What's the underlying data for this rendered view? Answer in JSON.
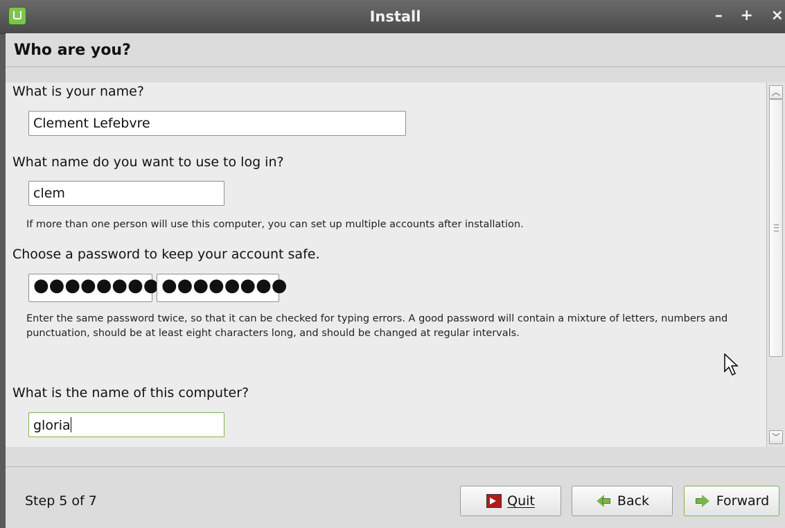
{
  "window": {
    "title": "Install",
    "controls": [
      "–",
      "+",
      "×"
    ]
  },
  "header": {
    "title": "Who are you?"
  },
  "form": {
    "name_question": "What is your name?",
    "name_value": "Clement Lefebvre",
    "login_question": "What name do you want to use to log in?",
    "login_value": "clem",
    "login_hint": "If more than one person will use this computer, you can set up multiple accounts after installation.",
    "password_question": "Choose a password to keep your account safe.",
    "password_value": "●●●●●●●●",
    "password_confirm_value": "●●●●●●●●",
    "password_hint": "Enter the same password twice, so that it can be checked for typing errors. A good password will contain a mixture of letters, numbers and punctuation, should be at least eight characters long, and should be changed at regular intervals.",
    "computer_question": "What is the name of this computer?",
    "computer_value": "gloria"
  },
  "footer": {
    "step_label": "Step 5 of 7",
    "quit_label": "Quit",
    "back_label": "Back",
    "forward_label": "Forward"
  },
  "icons": {
    "app": "linux-mint-icon",
    "quit": "quit-icon",
    "back": "back-arrow-icon",
    "forward": "forward-arrow-icon"
  },
  "colors": {
    "titlebar": "#4f4f4f",
    "focus_border": "#7fb54b",
    "arrow_green": "#7ab648"
  }
}
